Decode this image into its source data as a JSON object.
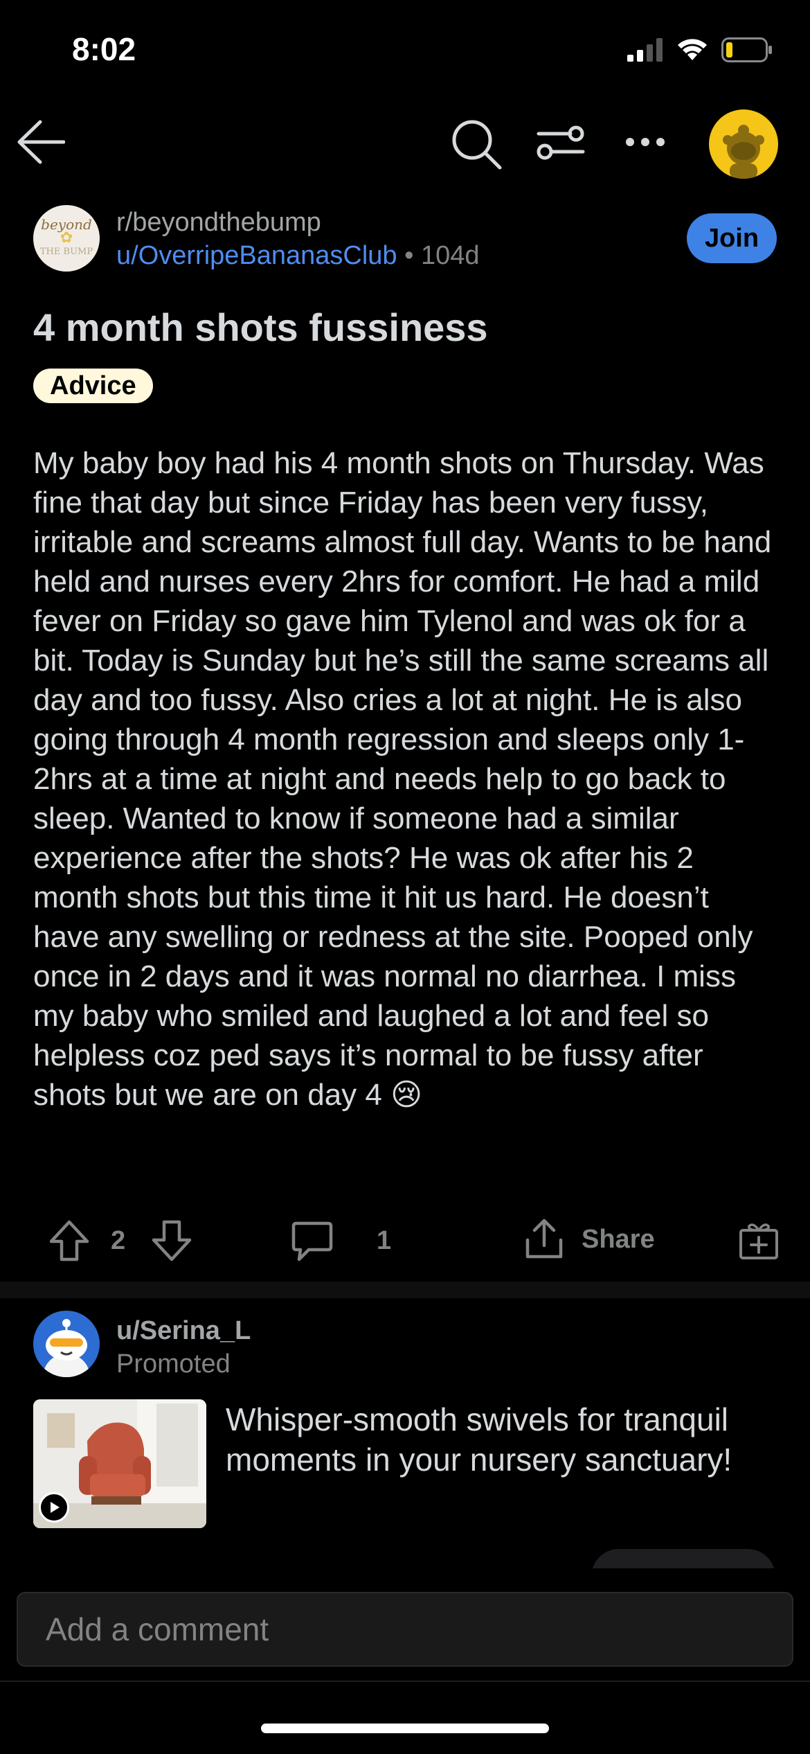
{
  "status_bar": {
    "time": "8:02"
  },
  "toolbar": {
    "back_icon": "arrow-left-icon",
    "search_icon": "search-icon",
    "filter_icon": "sort-filter-icon",
    "more_icon": "more-horizontal-icon",
    "avatar_icon": "snoo-avatar"
  },
  "post": {
    "subreddit": "r/beyondthebump",
    "author": "u/OverripeBananasClub",
    "separator": " • ",
    "age": "104d",
    "join_label": "Join",
    "title": "4 month shots fussiness",
    "flair": "Advice",
    "body": "My baby boy had his 4 month shots on Thursday. Was fine that day but since Friday has been very fussy, irritable and screams almost full day. Wants to be hand held and nurses every 2hrs for comfort. He had a mild fever on Friday so gave him Tylenol and was ok for a bit. Today is Sunday but he’s still the same screams all day and too fussy. Also cries a lot at night. He is also going through 4 month regression and sleeps only 1-2hrs at a time at night and needs help to go back to sleep. Wanted to know if someone had a similar experience after the shots? He was ok after his 2 month shots but this time it hit us hard. He doesn’t have any swelling or redness at the site. Pooped only once in 2 days and it was normal no diarrhea. I miss my baby who smiled and laughed a lot and feel so helpless coz ped says it’s normal to be fussy after shots but we are on day 4",
    "body_emoji": "😢",
    "sub_icon_text": {
      "line1": "beyond",
      "line2": "THE BUMP"
    }
  },
  "actions": {
    "upvote_count": "2",
    "comment_count": "1",
    "share_label": "Share"
  },
  "promoted": {
    "user": "u/Serina_L",
    "label": "Promoted",
    "text": "Whisper-smooth swivels for tranquil moments in your nursery sanctuary!"
  },
  "comment_box": {
    "placeholder": "Add a comment"
  },
  "colors": {
    "background": "#000000",
    "accent_blue": "#3e82e6",
    "author_link": "#4f8df0",
    "flair_bg": "#fff8dc",
    "avatar_yellow": "#f5c518",
    "battery_low": "#f5d40f"
  }
}
